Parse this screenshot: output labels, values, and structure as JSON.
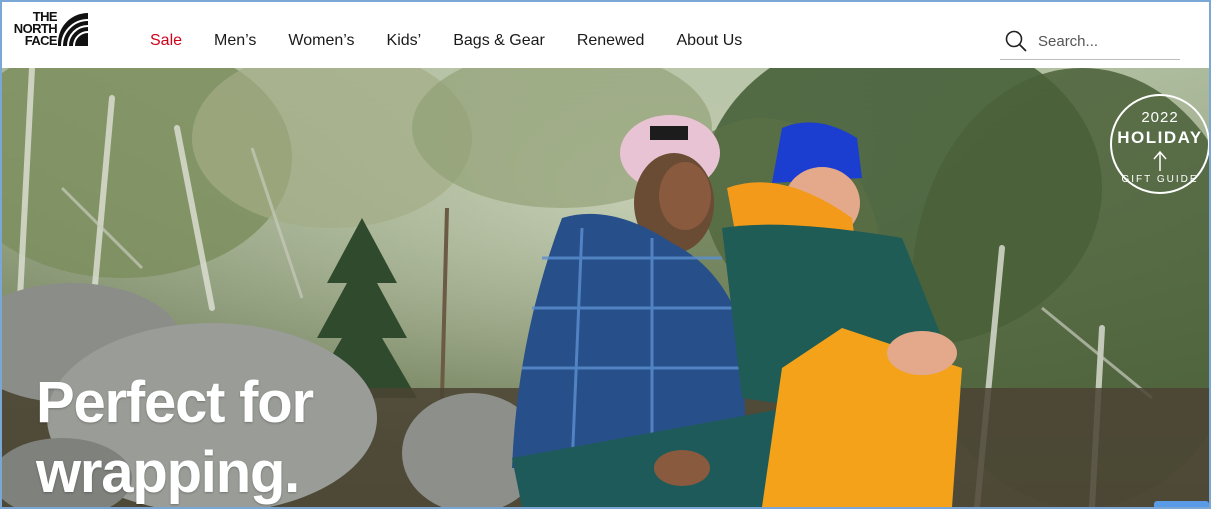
{
  "brand": {
    "logo_lines": [
      "THE",
      "NORTH",
      "FACE"
    ]
  },
  "nav": {
    "items": [
      {
        "label": "Sale",
        "color": "#d0021b"
      },
      {
        "label": "Men’s"
      },
      {
        "label": "Women’s"
      },
      {
        "label": "Kids’"
      },
      {
        "label": "Bags & Gear"
      },
      {
        "label": "Renewed"
      },
      {
        "label": "About Us"
      }
    ]
  },
  "search": {
    "placeholder": "Search...",
    "icon": "search-icon"
  },
  "hero": {
    "headline_line1": "Perfect for",
    "headline_line2": "wrapping.",
    "badge": {
      "year": "2022",
      "title": "HOLIDAY",
      "subtitle": "GIFT GUIDE",
      "icon": "arrow-up-icon"
    }
  }
}
